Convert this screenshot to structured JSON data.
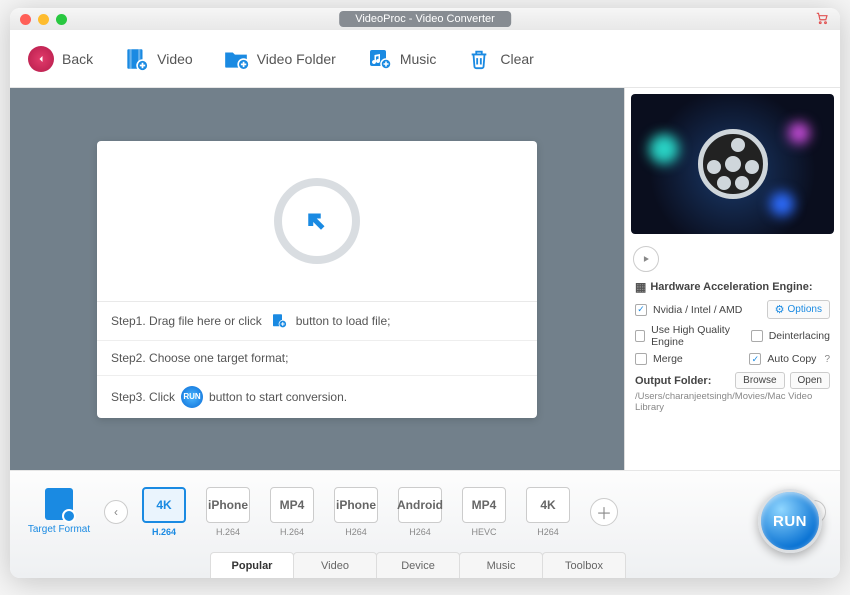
{
  "window": {
    "title": "VideoProc - Video Converter"
  },
  "toolbar": {
    "back": "Back",
    "video": "Video",
    "video_folder": "Video Folder",
    "music": "Music",
    "clear": "Clear"
  },
  "steps": {
    "s1a": "Step1. Drag file here or click",
    "s1b": "button to load file;",
    "s2": "Step2. Choose one target format;",
    "s3a": "Step3. Click",
    "s3b": "button to start conversion.",
    "run_mini": "RUN"
  },
  "side": {
    "hw_title": "Hardware Acceleration Engine:",
    "hw_label": "Nvidia / Intel / AMD",
    "options": "Options",
    "hqe": "Use High Quality Engine",
    "deint": "Deinterlacing",
    "merge": "Merge",
    "autocopy": "Auto Copy",
    "output_label": "Output Folder:",
    "browse": "Browse",
    "open": "Open",
    "path": "/Users/charanjeetsingh/Movies/Mac Video Library"
  },
  "bottom": {
    "target_format": "Target Format",
    "presets": [
      {
        "badge": "4K",
        "codec": "H.264",
        "selected": true
      },
      {
        "badge": "iPhone",
        "codec": "H.264",
        "selected": false
      },
      {
        "badge": "MP4",
        "codec": "H.264",
        "selected": false
      },
      {
        "badge": "iPhone",
        "codec": "H264",
        "selected": false
      },
      {
        "badge": "Android",
        "codec": "H264",
        "selected": false
      },
      {
        "badge": "MP4",
        "codec": "HEVC",
        "selected": false
      },
      {
        "badge": "4K",
        "codec": "H264",
        "selected": false
      }
    ],
    "tabs": [
      "Popular",
      "Video",
      "Device",
      "Music",
      "Toolbox"
    ],
    "active_tab": 0,
    "run": "RUN"
  }
}
